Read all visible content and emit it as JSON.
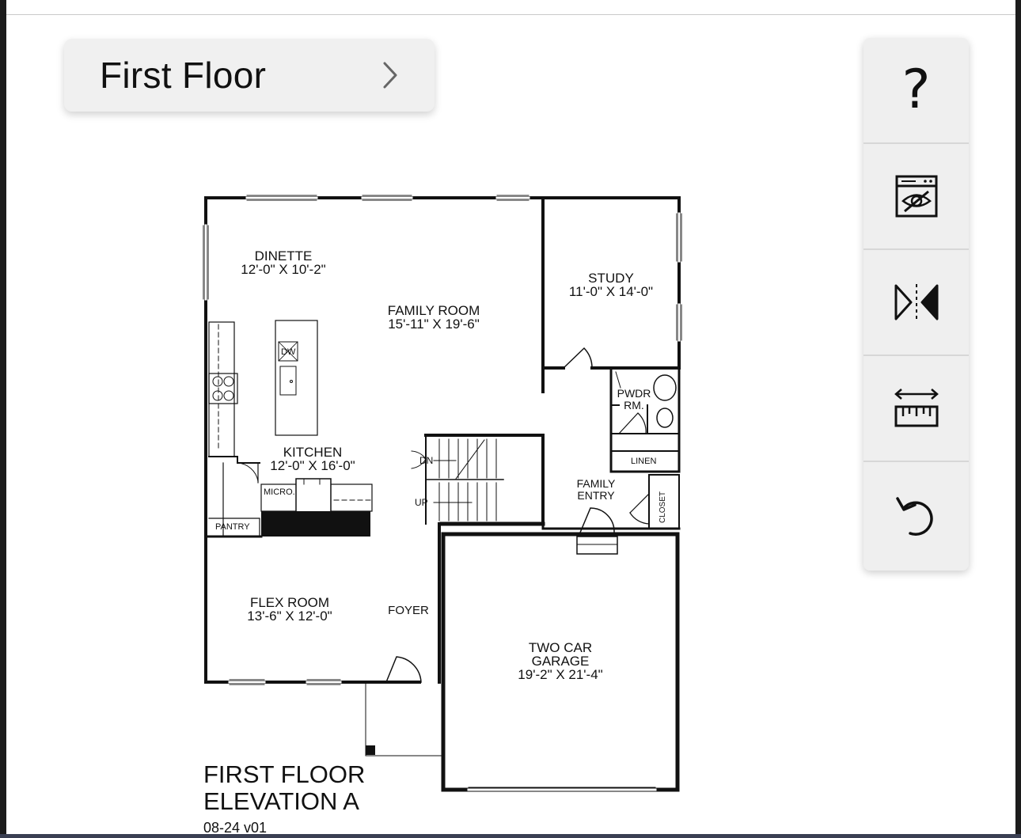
{
  "floor_selector": {
    "label": "First Floor"
  },
  "toolbar": {
    "buttons": [
      {
        "name": "help",
        "icon": "question-mark-icon",
        "glyph": "?"
      },
      {
        "name": "hide-furniture",
        "icon": "eye-slash-appliance-icon"
      },
      {
        "name": "mirror",
        "icon": "mirror-flip-icon"
      },
      {
        "name": "measure",
        "icon": "ruler-icon"
      },
      {
        "name": "reset",
        "icon": "undo-icon"
      }
    ]
  },
  "floor_plan": {
    "rooms": {
      "dinette": {
        "name": "DINETTE",
        "dims": "12'-0\" X 10'-2\""
      },
      "family_room": {
        "name": "FAMILY ROOM",
        "dims": "15'-11\" X 19'-6\""
      },
      "study": {
        "name": "STUDY",
        "dims": "11'-0\" X 14'-0\""
      },
      "kitchen": {
        "name": "KITCHEN",
        "dims": "12'-0\" X 16'-0\""
      },
      "flex_room": {
        "name": "FLEX ROOM",
        "dims": "13'-6\" X 12'-0\""
      },
      "garage": {
        "name_line1": "TWO CAR",
        "name_line2": "GARAGE",
        "dims": "19'-2\" X 21'-4\""
      },
      "pwdr": {
        "line1": "PWDR",
        "line2": "RM."
      },
      "family_entry": {
        "line1": "FAMILY",
        "line2": "ENTRY"
      },
      "foyer": "FOYER"
    },
    "small_labels": {
      "dw": "DW",
      "dn": "DN",
      "up": "UP",
      "micro": "MICRO.",
      "pantry": "PANTRY",
      "linen": "LINEN",
      "closet": "CLOSET"
    },
    "title_line1": "FIRST FLOOR",
    "title_line2": "ELEVATION A",
    "version": "08-24 v01"
  }
}
